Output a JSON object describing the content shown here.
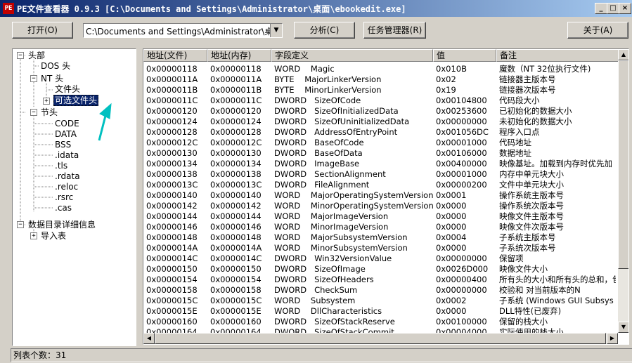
{
  "window": {
    "title": "PE文件查看器 0.9.3 [C:\\Documents and Settings\\Administrator\\桌面\\ebookedit.exe]",
    "icon_text": "PE",
    "minimize": "_",
    "maximize": "□",
    "close": "×"
  },
  "toolbar": {
    "open_label": "打开(O)",
    "path_value": "C:\\Documents and Settings\\Administrator\\桌面\\",
    "analyze_label": "分析(C)",
    "taskmgr_label": "任务管理器(R)",
    "about_label": "关于(A)"
  },
  "tree": {
    "header": "头部",
    "dos": "DOS 头",
    "nt": "NT 头",
    "file_header": "文件头",
    "optional_header": "可选文件头",
    "sections": "节头",
    "section_items": [
      "CODE",
      "DATA",
      "BSS",
      ".idata",
      ".tls",
      ".rdata",
      ".reloc",
      ".rsrc",
      ".cas"
    ],
    "data_dir": "数据目录详细信息",
    "import_table": "导入表"
  },
  "list": {
    "columns": [
      "地址(文件)",
      "地址(内存)",
      "字段定义",
      "值",
      "备注"
    ],
    "rows": [
      [
        "0x00000118",
        "0x00000118",
        "WORD    Magic",
        "0x010B",
        "魔数（NT 32位执行文件)"
      ],
      [
        "0x0000011A",
        "0x0000011A",
        "BYTE    MajorLinkerVersion",
        "0x02",
        "链接器主版本号"
      ],
      [
        "0x0000011B",
        "0x0000011B",
        "BYTE    MinorLinkerVersion",
        "0x19",
        "链接器次版本号"
      ],
      [
        "0x0000011C",
        "0x0000011C",
        "DWORD   SizeOfCode",
        "0x00104800",
        "代码段大小"
      ],
      [
        "0x00000120",
        "0x00000120",
        "DWORD   SizeOfInitializedData",
        "0x00253600",
        "已初始化的数据大小"
      ],
      [
        "0x00000124",
        "0x00000124",
        "DWORD   SizeOfUninitializedData",
        "0x00000000",
        "未初始化的数据大小"
      ],
      [
        "0x00000128",
        "0x00000128",
        "DWORD   AddressOfEntryPoint",
        "0x001056DC",
        "程序入口点"
      ],
      [
        "0x0000012C",
        "0x0000012C",
        "DWORD   BaseOfCode",
        "0x00001000",
        "代码地址"
      ],
      [
        "0x00000130",
        "0x00000130",
        "DWORD   BaseOfData",
        "0x00106000",
        "数据地址"
      ],
      [
        "0x00000134",
        "0x00000134",
        "DWORD   ImageBase",
        "0x00400000",
        "映像基址。加载到内存时优先加"
      ],
      [
        "0x00000138",
        "0x00000138",
        "DWORD   SectionAlignment",
        "0x00001000",
        "内存中单元块大小"
      ],
      [
        "0x0000013C",
        "0x0000013C",
        "DWORD   FileAlignment",
        "0x00000200",
        "文件中单元块大小"
      ],
      [
        "0x00000140",
        "0x00000140",
        "WORD    MajorOperatingSystemVersion",
        "0x0001",
        "操作系统主版本号"
      ],
      [
        "0x00000142",
        "0x00000142",
        "WORD    MinorOperatingSystemVersion",
        "0x0000",
        "操作系统次版本号"
      ],
      [
        "0x00000144",
        "0x00000144",
        "WORD    MajorImageVersion",
        "0x0000",
        "映像文件主版本号"
      ],
      [
        "0x00000146",
        "0x00000146",
        "WORD    MinorImageVersion",
        "0x0000",
        "映像文件次版本号"
      ],
      [
        "0x00000148",
        "0x00000148",
        "WORD    MajorSubsystemVersion",
        "0x0004",
        "子系统主版本号"
      ],
      [
        "0x0000014A",
        "0x0000014A",
        "WORD    MinorSubsystemVersion",
        "0x0000",
        "子系统次版本号"
      ],
      [
        "0x0000014C",
        "0x0000014C",
        "DWORD   Win32VersionValue",
        "0x00000000",
        "保留项"
      ],
      [
        "0x00000150",
        "0x00000150",
        "DWORD   SizeOfImage",
        "0x0026D000",
        "映像文件大小"
      ],
      [
        "0x00000154",
        "0x00000154",
        "DWORD   SizeOfHeaders",
        "0x00000400",
        "所有头的大小和所有头的总和，包"
      ],
      [
        "0x00000158",
        "0x00000158",
        "DWORD   CheckSum",
        "0x00000000",
        "校验和          对当前版本的N"
      ],
      [
        "0x0000015C",
        "0x0000015C",
        "WORD    Subsystem",
        "0x0002",
        "子系统 (Windows GUI Subsys"
      ],
      [
        "0x0000015E",
        "0x0000015E",
        "WORD    DllCharacteristics",
        "0x0000",
        "DLL特性(已废弃)"
      ],
      [
        "0x00000160",
        "0x00000160",
        "DWORD   SizeOfStackReserve",
        "0x00100000",
        "保留的栈大小"
      ],
      [
        "0x00000164",
        "0x00000164",
        "DWORD   SizeOfStackCommit",
        "0x00004000",
        "实际使用的栈大小"
      ]
    ]
  },
  "status": {
    "count_text": "列表个数：31"
  },
  "colors": {
    "title_start": "#0a246a",
    "title_end": "#a6caf0",
    "face": "#d4d0c8",
    "selection": "#0a246a",
    "annotation_arrow": "#00c0c0"
  }
}
